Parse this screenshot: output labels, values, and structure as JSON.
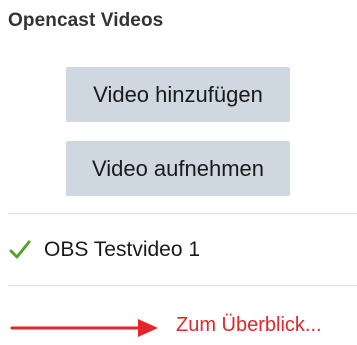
{
  "panel": {
    "title": "Opencast Videos"
  },
  "actions": {
    "add_video_label": "Video hinzufügen",
    "record_video_label": "Video aufnehmen"
  },
  "videos": [
    {
      "title": "OBS Testvideo 1",
      "status_icon": "checkmark-icon"
    }
  ],
  "footer": {
    "overview_link_label": "Zum Überblick...",
    "arrow_icon": "right-arrow-icon"
  },
  "colors": {
    "button_bg": "#cfd7e0",
    "check_green": "#5aa02c",
    "link_red": "#e3262c",
    "arrow_red": "#e3262c"
  }
}
